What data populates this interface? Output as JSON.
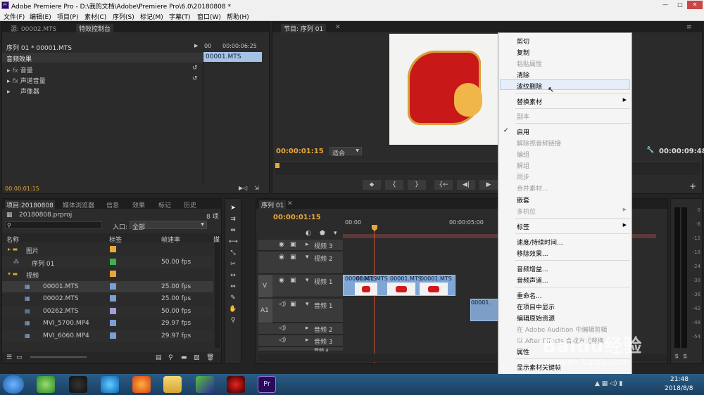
{
  "window": {
    "title": "Adobe Premiere Pro - D:\\我的文档\\Adobe\\Premiere Pro\\6.0\\20180808 *"
  },
  "menubar": [
    "文件(F)",
    "编辑(E)",
    "项目(P)",
    "素材(C)",
    "序列(S)",
    "标记(M)",
    "字幕(T)",
    "窗口(W)",
    "帮助(H)"
  ],
  "source_panel": {
    "tab_source": "源: 00002.MTS",
    "tab_effects": "特效控制台",
    "sequence_label": "序列 01 * 00001.MTS",
    "time_start": "00",
    "time_end": "00:00:06:25",
    "clip_name": "00001.MTS",
    "section": "音频效果",
    "effects": [
      "音量",
      "声道音量",
      "声像器"
    ],
    "timecode": "00:00:01:15"
  },
  "program_panel": {
    "tab": "节目: 序列 01",
    "timecode": "00:00:01:15",
    "fit": "适合",
    "duration": "00:00:09:48"
  },
  "project_panel": {
    "tabs": [
      "项目:20180808",
      "媒体浏览器",
      "信息",
      "效果",
      "标记",
      "历史"
    ],
    "project_file": "20180808.prproj",
    "item_count": "8 项",
    "entry_label": "入口:",
    "entry_value": "全部",
    "columns": [
      "名称",
      "标签",
      "帧速率",
      "媒"
    ],
    "rows": [
      {
        "name": "图片",
        "rate": "",
        "color": "#e8a73a"
      },
      {
        "name": "序列 01",
        "rate": "50.00 fps",
        "color": "#3fae4e"
      },
      {
        "name": "视频",
        "rate": "",
        "color": "#e8a73a"
      },
      {
        "name": "00001.MTS",
        "rate": "25.00 fps",
        "color": "#7a9fd0"
      },
      {
        "name": "00002.MTS",
        "rate": "25.00 fps",
        "color": "#7a9fd0"
      },
      {
        "name": "00262.MTS",
        "rate": "50.00 fps",
        "color": "#a99ad6"
      },
      {
        "name": "MVI_5700.MP4",
        "rate": "29.97 fps",
        "color": "#7a9fd0"
      },
      {
        "name": "MVI_6060.MP4",
        "rate": "29.97 fps",
        "color": "#7a9fd0"
      }
    ]
  },
  "timeline": {
    "tab": "序列 01",
    "timecode": "00:00:01:15",
    "ruler": [
      "00:00",
      "00:00:05:00"
    ],
    "tracks": [
      "视频 3",
      "视频 2",
      "视频 1",
      "音频 1",
      "音频 2",
      "音频 3",
      "音频 4"
    ],
    "v_label": "V",
    "a_label": "A1",
    "clips": [
      "00001.MTS",
      "00001.MTS",
      "00001.MTS",
      "00001.MTS"
    ],
    "audio_clip": "00001."
  },
  "meters": [
    "0",
    "-6",
    "-12",
    "-18",
    "-24",
    "-30",
    "-36",
    "-42",
    "-48",
    "-54"
  ],
  "context_menu": {
    "items": [
      {
        "label": "剪切",
        "disabled": false
      },
      {
        "label": "复制",
        "disabled": false
      },
      {
        "label": "粘贴属性",
        "disabled": true
      },
      {
        "label": "清除",
        "disabled": false
      },
      {
        "label": "波纹删除",
        "disabled": false
      },
      {
        "label": "替换素材",
        "disabled": false
      },
      {
        "label": "副本",
        "disabled": true
      },
      {
        "label": "启用",
        "disabled": false
      },
      {
        "label": "解除视音频链接",
        "disabled": true
      },
      {
        "label": "编组",
        "disabled": true
      },
      {
        "label": "解组",
        "disabled": true
      },
      {
        "label": "同步",
        "disabled": true
      },
      {
        "label": "合并素材...",
        "disabled": true
      },
      {
        "label": "嵌套",
        "disabled": false
      },
      {
        "label": "多机位",
        "disabled": true
      },
      {
        "label": "标签",
        "disabled": false
      },
      {
        "label": "速度/持续时间...",
        "disabled": false
      },
      {
        "label": "移除效果...",
        "disabled": false
      },
      {
        "label": "音频增益...",
        "disabled": false
      },
      {
        "label": "音频声道...",
        "disabled": false
      },
      {
        "label": "重命名...",
        "disabled": false
      },
      {
        "label": "在项目中显示",
        "disabled": false
      },
      {
        "label": "编辑原始资源",
        "disabled": false
      },
      {
        "label": "在 Adobe Audition 中编辑剪辑",
        "disabled": true
      },
      {
        "label": "以 After Effects 合成方式替换",
        "disabled": true
      },
      {
        "label": "属性",
        "disabled": false
      },
      {
        "label": "显示素材关键帧",
        "disabled": false
      }
    ]
  },
  "taskbar": {
    "time": "21:48",
    "date": "2018/8/8"
  },
  "watermark": "Baidu经验 jingyan.baidu.com"
}
